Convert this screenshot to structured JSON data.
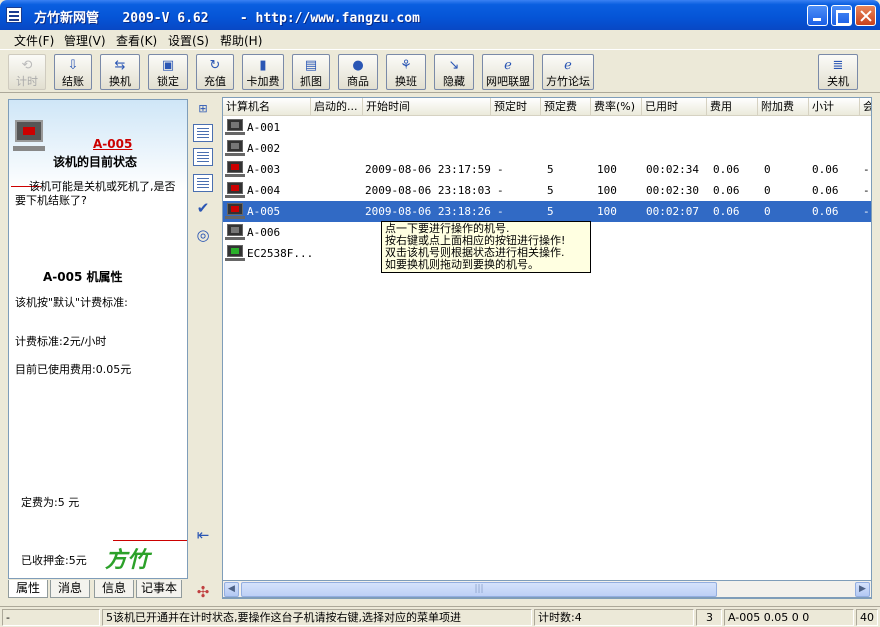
{
  "window": {
    "title": "方竹新网管   2009-V 6.62    - http://www.fangzu.com"
  },
  "menu": [
    {
      "label": "文件(F)"
    },
    {
      "label": "管理(V)"
    },
    {
      "label": "查看(K)"
    },
    {
      "label": "设置(S)"
    },
    {
      "label": "帮助(H)"
    }
  ],
  "toolbar": [
    {
      "label": "计时",
      "icon": "timer-icon",
      "disabled": true
    },
    {
      "label": "结账",
      "icon": "checkout-icon"
    },
    {
      "label": "换机",
      "icon": "swap-machine-icon"
    },
    {
      "label": "锁定",
      "icon": "lock-icon"
    },
    {
      "label": "充值",
      "icon": "recharge-icon"
    },
    {
      "label": "卡加费",
      "icon": "card-fee-icon"
    },
    {
      "label": "抓图",
      "icon": "screenshot-icon"
    },
    {
      "label": "商品",
      "icon": "goods-icon"
    },
    {
      "label": "换班",
      "icon": "shift-icon"
    },
    {
      "label": "隐藏",
      "icon": "hide-icon"
    },
    {
      "label": "网吧联盟",
      "icon": "ie-icon"
    },
    {
      "label": "方竹论坛",
      "icon": "ie-icon"
    },
    {
      "label": "关机",
      "icon": "shutdown-icon"
    }
  ],
  "left_panel": {
    "machine_name": "A-005",
    "status_title": "该机的目前状态",
    "status_text_1": "该机可能是关机或死机了,是否",
    "status_text_2": "要下机结账了?",
    "props_title": "A-005  机属性",
    "billing_mode": "该机按\"默认\"计费标准:",
    "billing_rate": "计费标准:2元/小时",
    "used_fee": "目前已使用费用:0.05元",
    "fixed_fee": "定费为:5 元",
    "deposit": "已收押金:5元",
    "brand": "方竹",
    "tabs": [
      "属性",
      "消息",
      "信息",
      "记事本"
    ]
  },
  "list": {
    "columns": [
      "计算机名",
      "启动的...",
      "开始时间",
      "预定时",
      "预定费",
      "费率(%)",
      "已用时",
      "费用",
      "附加费",
      "小计",
      "会"
    ],
    "rows": [
      {
        "name": "A-001",
        "state": "off",
        "start": "",
        "reserve_time": "",
        "reserve_fee": "",
        "rate": "",
        "used": "",
        "fee": "",
        "extra": "",
        "subtotal": "",
        "member": ""
      },
      {
        "name": "A-002",
        "state": "off",
        "start": "",
        "reserve_time": "",
        "reserve_fee": "",
        "rate": "",
        "used": "",
        "fee": "",
        "extra": "",
        "subtotal": "",
        "member": ""
      },
      {
        "name": "A-003",
        "state": "red",
        "start": "2009-08-06 23:17:59",
        "reserve_time": "-",
        "reserve_fee": "5",
        "rate": "100",
        "used": "00:02:34",
        "fee": "0.06",
        "extra": "0",
        "subtotal": "0.06",
        "member": "-"
      },
      {
        "name": "A-004",
        "state": "red",
        "start": "2009-08-06 23:18:03",
        "reserve_time": "-",
        "reserve_fee": "5",
        "rate": "100",
        "used": "00:02:30",
        "fee": "0.06",
        "extra": "0",
        "subtotal": "0.06",
        "member": "-"
      },
      {
        "name": "A-005",
        "state": "red",
        "start": "2009-08-06 23:18:26",
        "reserve_time": "-",
        "reserve_fee": "5",
        "rate": "100",
        "used": "00:02:07",
        "fee": "0.06",
        "extra": "0",
        "subtotal": "0.06",
        "member": "-",
        "selected": true
      },
      {
        "name": "A-006",
        "state": "off",
        "start": "",
        "reserve_time": "",
        "reserve_fee": "",
        "rate": "",
        "used": "",
        "fee": "",
        "extra": "",
        "subtotal": "",
        "member": ""
      },
      {
        "name": "EC2538F...",
        "state": "green",
        "start": "",
        "reserve_time": "",
        "reserve_fee": "",
        "rate": "",
        "used": "",
        "fee": "",
        "extra": "",
        "subtotal": "",
        "member": ""
      }
    ]
  },
  "tooltip": [
    "点一下要进行操作的机号.",
    "按右键或点上面相应的按钮进行操作!",
    "双击该机号则根据状态进行相关操作.",
    "如要换机则拖动到要换的机号。"
  ],
  "status_bar": {
    "left": "-",
    "message": "5该机已开通并在计时状态,要操作这台子机请按右键,选择对应的菜单项进",
    "timer_count": "计时数:4",
    "count": "3",
    "info": "A-005 0.05 0 0",
    "right": "40"
  }
}
